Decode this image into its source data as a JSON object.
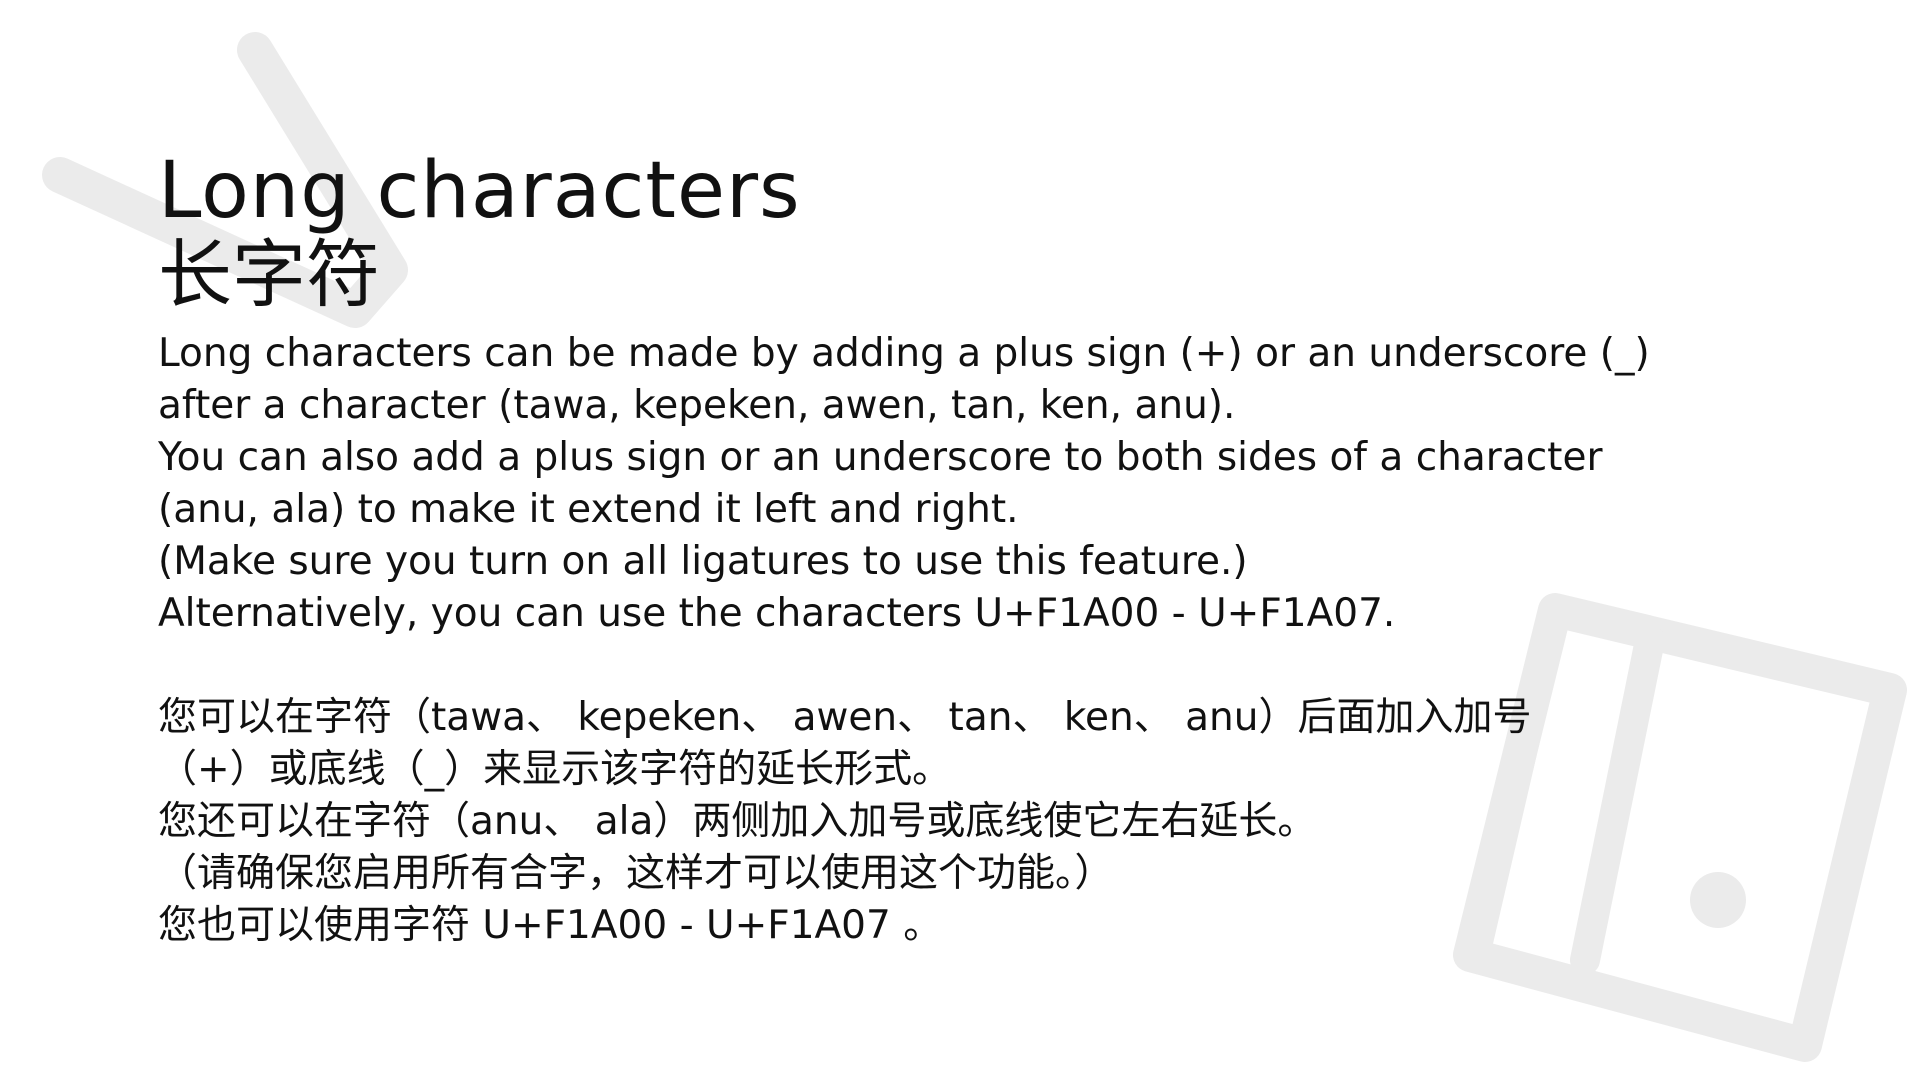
{
  "title_en": "Long characters",
  "title_zh": "长字符",
  "english_lines": [
    "Long characters can be made by adding a plus sign (+) or an underscore (_)",
    "after a character (tawa, kepeken, awen, tan, ken, anu).",
    "You can also add a plus sign or an underscore to both sides of a character",
    "(anu, ala) to make it extend it left and right.",
    "(Make sure you turn on all ligatures to use this feature.)",
    "Alternatively, you can use the characters U+F1A00 - U+F1A07."
  ],
  "chinese_lines": [
    "您可以在字符（tawa、 kepeken、 awen、 tan、 ken、 anu）后面加入加号",
    "（+）或底线（_）来显示该字符的延长形式。",
    "您还可以在字符（anu、 ala）两侧加入加号或底线使它左右延长。",
    "（请确保您启用所有合字，这样才可以使用这个功能。）",
    "您也可以使用字符 U+F1A00 - U+F1A07 。"
  ],
  "colors": {
    "background": "#ffffff",
    "text": "#111111",
    "watermark": "#ebebeb"
  }
}
